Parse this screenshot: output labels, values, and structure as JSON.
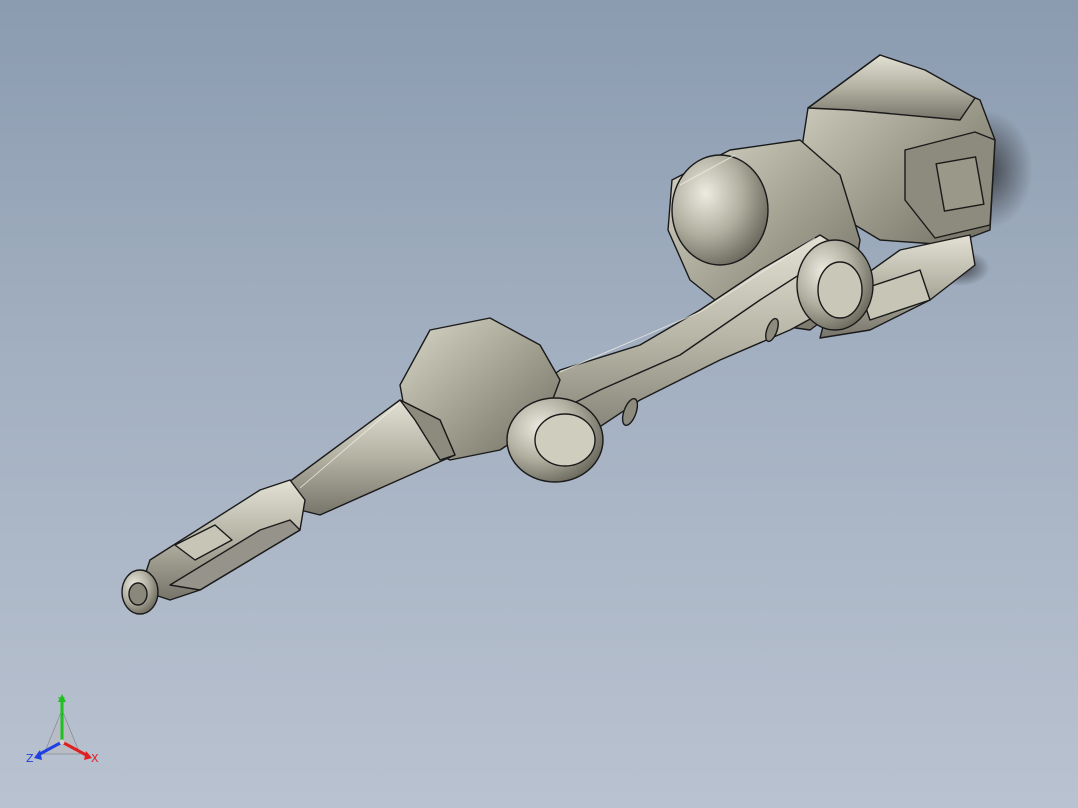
{
  "viewport": {
    "background_top": "#8b9bb0",
    "background_bottom": "#b9c2d0",
    "model_color": "#a8a696",
    "edge_color": "#1a1a1a"
  },
  "triad": {
    "x_label": "X",
    "y_label": "Y",
    "z_label": "Z",
    "x_color": "#e02020",
    "y_color": "#20c020",
    "z_color": "#2040e0"
  }
}
